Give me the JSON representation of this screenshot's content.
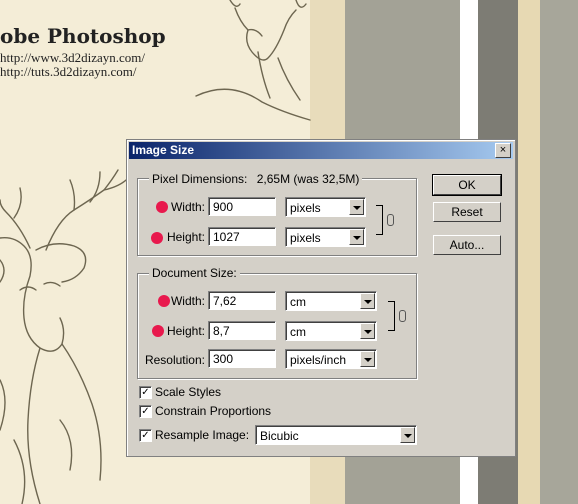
{
  "background": {
    "site_title": "obe Photoshop",
    "url_1": "http://www.3d2dizayn.com/",
    "url_2": "http://tuts.3d2dizayn.com/"
  },
  "dialog": {
    "title": "Image Size",
    "close_glyph": "×",
    "pixel_dimensions": {
      "label": "Pixel Dimensions:",
      "value": "2,65M (was 32,5M)",
      "width_label": "Width:",
      "width_value": "900",
      "width_unit": "pixels",
      "height_label": "Height:",
      "height_value": "1027",
      "height_unit": "pixels"
    },
    "document_size": {
      "label": "Document Size:",
      "width_label": "Width:",
      "width_value": "7,62",
      "width_unit": "cm",
      "height_label": "Height:",
      "height_value": "8,7",
      "height_unit": "cm",
      "resolution_label": "Resolution:",
      "resolution_value": "300",
      "resolution_unit": "pixels/inch"
    },
    "options": {
      "scale_styles": {
        "label": "Scale Styles",
        "checked": true
      },
      "constrain_proportions": {
        "label": "Constrain Proportions",
        "checked": true
      },
      "resample_image": {
        "label": "Resample Image:",
        "checked": true,
        "method": "Bicubic"
      }
    },
    "buttons": {
      "ok": "OK",
      "reset": "Reset",
      "auto": "Auto..."
    },
    "check_glyph": "✓"
  },
  "colors": {
    "title_bar": "#0a246a",
    "dialog_face": "#d4d0c8",
    "marker_dot": "#e8194d"
  }
}
